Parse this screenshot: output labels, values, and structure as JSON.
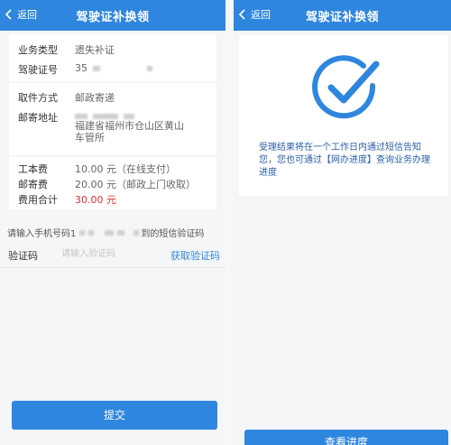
{
  "left": {
    "nav": {
      "back_label": "返回",
      "title": "驾驶证补换领"
    },
    "info": {
      "business_type_label": "业务类型",
      "business_type_value": "遗失补证",
      "license_no_label": "驾驶证号",
      "license_no_prefix": "35",
      "pickup_method_label": "取件方式",
      "pickup_method_value": "邮政寄递",
      "mail_address_label": "邮寄地址",
      "mail_address_line1": "福建省福州市仓山区黄山",
      "mail_address_line2": "车管所",
      "cost_fee_label": "工本费",
      "cost_fee_value": "10.00 元（在线支付）",
      "postage_label": "邮寄费",
      "postage_value": "20.00 元（邮政上门收取）",
      "total_label": "费用合计",
      "total_value": "30.00 元"
    },
    "phone_prompt_prefix": "请输入手机号码1",
    "phone_prompt_suffix": "到的短信验证码",
    "code_label": "验证码",
    "code_placeholder": "请输入验证码",
    "get_code_label": "获取验证码",
    "submit_label": "提交"
  },
  "right": {
    "nav": {
      "back_label": "返回",
      "title": "驾驶证补换领"
    },
    "result_text": "受理结果将在一个工作日内通过短信告知您，您也可通过【网办进度】查询业务办理进度",
    "view_progress_label": "查看进度"
  },
  "colors": {
    "brand_blue": "#2f86de",
    "total_red": "#e02f2f"
  }
}
